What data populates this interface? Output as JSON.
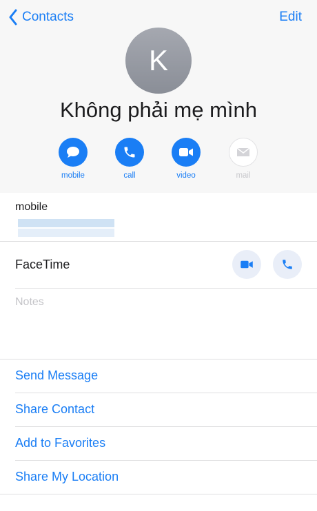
{
  "nav": {
    "back_label": "Contacts",
    "edit_label": "Edit"
  },
  "contact": {
    "initial": "K",
    "name": "Không phải mẹ mình"
  },
  "actions": [
    {
      "label": "mobile",
      "icon": "message-icon",
      "enabled": true
    },
    {
      "label": "call",
      "icon": "phone-icon",
      "enabled": true
    },
    {
      "label": "video",
      "icon": "video-icon",
      "enabled": true
    },
    {
      "label": "mail",
      "icon": "mail-icon",
      "enabled": false
    }
  ],
  "phone": {
    "label": "mobile"
  },
  "facetime": {
    "label": "FaceTime"
  },
  "notes": {
    "label": "Notes"
  },
  "links": [
    {
      "label": "Send Message"
    },
    {
      "label": "Share Contact"
    },
    {
      "label": "Add to Favorites"
    },
    {
      "label": "Share My Location"
    }
  ],
  "colors": {
    "accent": "#1a7ef5",
    "avatar": "#9a9da5",
    "header_bg": "#f7f7f7"
  }
}
